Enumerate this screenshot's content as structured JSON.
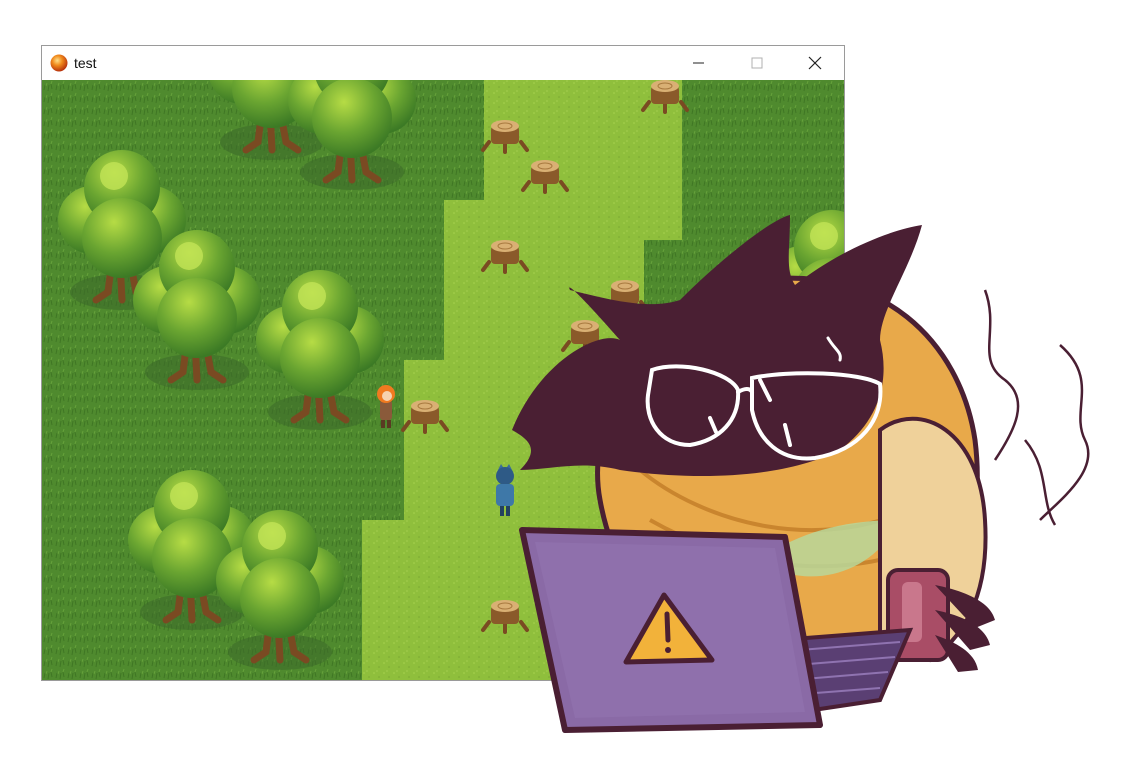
{
  "window": {
    "title": "test",
    "app_icon": "orange-orb-icon",
    "controls": [
      "minimize-icon",
      "maximize-icon",
      "close-icon"
    ]
  },
  "game": {
    "scene": "forest-map",
    "characters": [
      "orange-haired-npc",
      "blue-armored-player"
    ]
  },
  "overlay": {
    "mascot": "hooded-cat-with-laptop",
    "laptop_icon": "warning-icon"
  },
  "colors": {
    "grass_dark": "#4f8a2e",
    "grass_light": "#8fbf3c",
    "tree_leaf": "#6aa531",
    "mascot_hood": "#4a1f33",
    "mascot_body": "#e8a94a",
    "laptop": "#8a6aa6",
    "warning": "#f2b23a"
  }
}
